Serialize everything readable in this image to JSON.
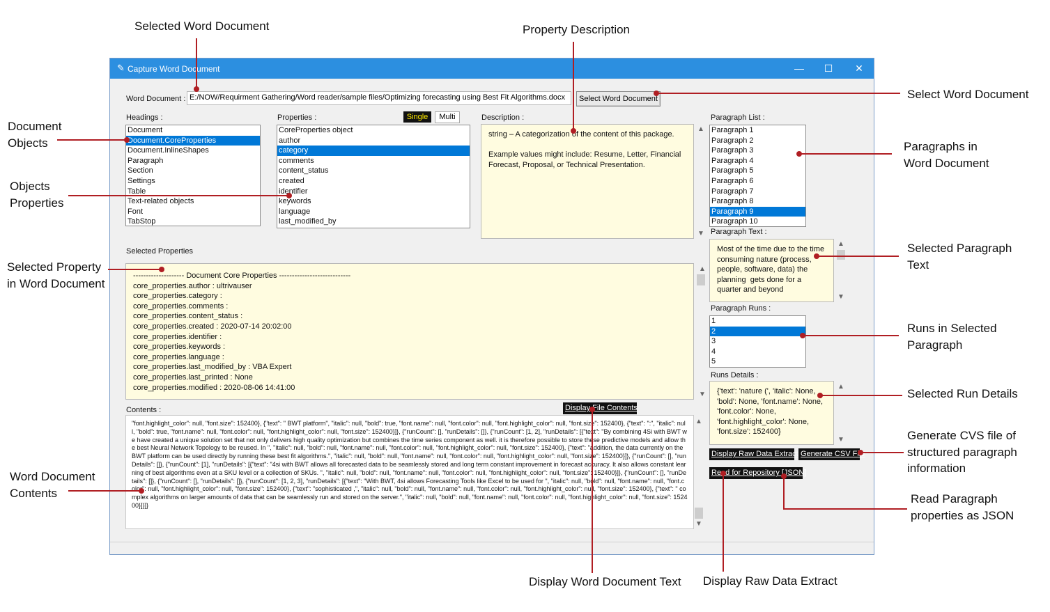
{
  "annotations": {
    "selected_word_document": "Selected Word Document",
    "property_description": "Property Description",
    "select_word_document": "Select Word Document",
    "document_objects": [
      "Document",
      "Objects"
    ],
    "objects_properties": [
      "Objects",
      "Properties"
    ],
    "paragraphs_in_word_document": [
      "Paragraphs in",
      "Word Document"
    ],
    "selected_property": [
      "Selected Property",
      "in Word Document"
    ],
    "selected_paragraph_text": [
      "Selected Paragraph",
      "Text"
    ],
    "runs_in_selected_paragraph": [
      "Runs in Selected",
      "Paragraph"
    ],
    "selected_run_details": "Selected Run Details",
    "generate_csv": [
      "Generate CVS file of",
      "structured paragraph",
      "information"
    ],
    "word_document_contents": [
      "Word Document",
      "Contents"
    ],
    "read_paragraph_json": [
      "Read Paragraph",
      "properties as JSON"
    ],
    "display_word_document_text": "Display Word Document Text",
    "display_raw_data_extract": "Display Raw Data Extract"
  },
  "window": {
    "title": "Capture Word Document",
    "minimize": "—",
    "maximize": "☐",
    "close": "✕"
  },
  "word_document": {
    "label": "Word Document :",
    "path": "E:/NOW/Requirment Gathering/Word reader/sample files/Optimizing forecasting using Best Fit Algorithms.docx",
    "button": "Select Word Document"
  },
  "headings": {
    "label": "Headings :",
    "items": [
      "Document",
      "Document.CoreProperties",
      "Document.InlineShapes",
      "Paragraph",
      "Section",
      "Settings",
      "Table",
      "Text-related objects",
      "Font",
      "TabStop"
    ],
    "selected_index": 1
  },
  "properties": {
    "label": "Properties :",
    "single": "Single",
    "multi": "Multi",
    "items": [
      "CoreProperties object",
      "author",
      "category",
      "comments",
      "content_status",
      "created",
      "identifier",
      "keywords",
      "language",
      "last_modified_by"
    ],
    "selected_index": 2
  },
  "description": {
    "label": "Description :",
    "text": "string – A categorization of the content of this package.\n\nExample values might include: Resume, Letter, Financial Forecast, Proposal, or Technical Presentation."
  },
  "paragraph_list": {
    "label": "Paragraph List :",
    "items": [
      "Paragraph 1",
      "Paragraph 2",
      "Paragraph 3",
      "Paragraph 4",
      "Paragraph 5",
      "Paragraph 6",
      "Paragraph 7",
      "Paragraph 8",
      "Paragraph 9",
      "Paragraph 10"
    ],
    "selected_index": 8
  },
  "paragraph_text": {
    "label": "Paragraph Text :",
    "text": "Most of the time due to the time consuming nature (process, people, software, data) the planning  gets done for a quarter and beyond"
  },
  "paragraph_runs": {
    "label": "Paragraph Runs :",
    "items": [
      "1",
      "2",
      "3",
      "4",
      "5"
    ],
    "selected_index": 1
  },
  "runs_details": {
    "label": "Runs Details :",
    "text": "{'text': 'nature (', 'italic': None, 'bold': None, 'font.name': None, 'font.color': None, 'font.highlight_color': None, 'font.size': 152400}"
  },
  "selected_properties": {
    "label": "Selected Properties",
    "lines": [
      "-------------------- Document Core Properties ----------------------------",
      "core_properties.author :  ultrivauser",
      "core_properties.category :",
      "core_properties.comments :",
      "core_properties.content_status :",
      "core_properties.created :  2020-07-14 20:02:00",
      "core_properties.identifier :",
      "core_properties.keywords :",
      "core_properties.language :",
      "core_properties.last_modified_by :  VBA Expert",
      "core_properties.last_printed :  None",
      "core_properties.modified :  2020-08-06 14:41:00"
    ]
  },
  "contents": {
    "label": "Contents :",
    "display_button": "Display File Contents",
    "text": "\"font.highlight_color\": null, \"font.size\": 152400}, {\"text\": \" BWT platform\", \"italic\": null, \"bold\": true, \"font.name\": null, \"font.color\": null, \"font.highlight_color\": null, \"font.size\": 152400}, {\"text\": \":\", \"italic\": null, \"bold\": true, \"font.name\": null, \"font.color\": null, \"font.highlight_color\": null, \"font.size\": 152400}]}, {\"runCount\": [], \"runDetails\": []}, {\"runCount\": [1, 2], \"runDetails\": [{\"text\": \"By combining 4Si with BWT we have created a unique solution set that not only delivers high quality optimization but combines the time series component as well. it is therefore possible to store these predictive models and allow the best Neural Network Topology to be reused. In \", \"italic\": null, \"bold\": null, \"font.name\": null, \"font.color\": null, \"font.highlight_color\": null, \"font.size\": 152400}, {\"text\": \"addition, the data currently on the BWT platform can be used directly by running these best fit algorithms.\", \"italic\": null, \"bold\": null, \"font.name\": null, \"font.color\": null, \"font.highlight_color\": null, \"font.size\": 152400}]}, {\"runCount\": [], \"runDetails\": []}, {\"runCount\": [1], \"runDetails\": [{\"text\": \"4si with BWT allows all forecasted data to be seamlessly stored and long term constant improvement in forecast accuracy. It also allows constant learning of best algorithms even at a SKU level or a collection of SKUs. \", \"italic\": null, \"bold\": null, \"font.name\": null, \"font.color\": null, \"font.highlight_color\": null, \"font.size\": 152400}]}, {\"runCount\": [], \"runDetails\": []}, {\"runCount\": [], \"runDetails\": []}, {\"runCount\": [1, 2, 3], \"runDetails\": [{\"text\": \"With BWT, 4si allows Forecasting Tools like Excel to be used for \", \"italic\": null, \"bold\": null, \"font.name\": null, \"font.color\": null, \"font.highlight_color\": null, \"font.size\": 152400}, {\"text\": \"sophisticated ,\", \"italic\": null, \"bold\": null, \"font.name\": null, \"font.color\": null, \"font.highlight_color\": null, \"font.size\": 152400}, {\"text\": \" complex algorithms on larger amounts of data that can be seamlessly run and stored on the server.\", \"italic\": null, \"bold\": null, \"font.name\": null, \"font.color\": null, \"font.highlight_color\": null, \"font.size\": 152400}]}]}"
  },
  "buttons": {
    "display_raw": "Display Raw Data Extract",
    "generate_csv": "Generate CSV File",
    "read_repository": "Read for Repository [JSON]"
  },
  "icons": {
    "app": "feather-icon",
    "scroll_up": "▲",
    "scroll_down": "▼"
  },
  "colors": {
    "annotation_line": "#b01e23",
    "titlebar": "#2c8fe0",
    "selection": "#0078d7",
    "panel_yellow": "#fffce0",
    "single_text": "#ffea00"
  }
}
